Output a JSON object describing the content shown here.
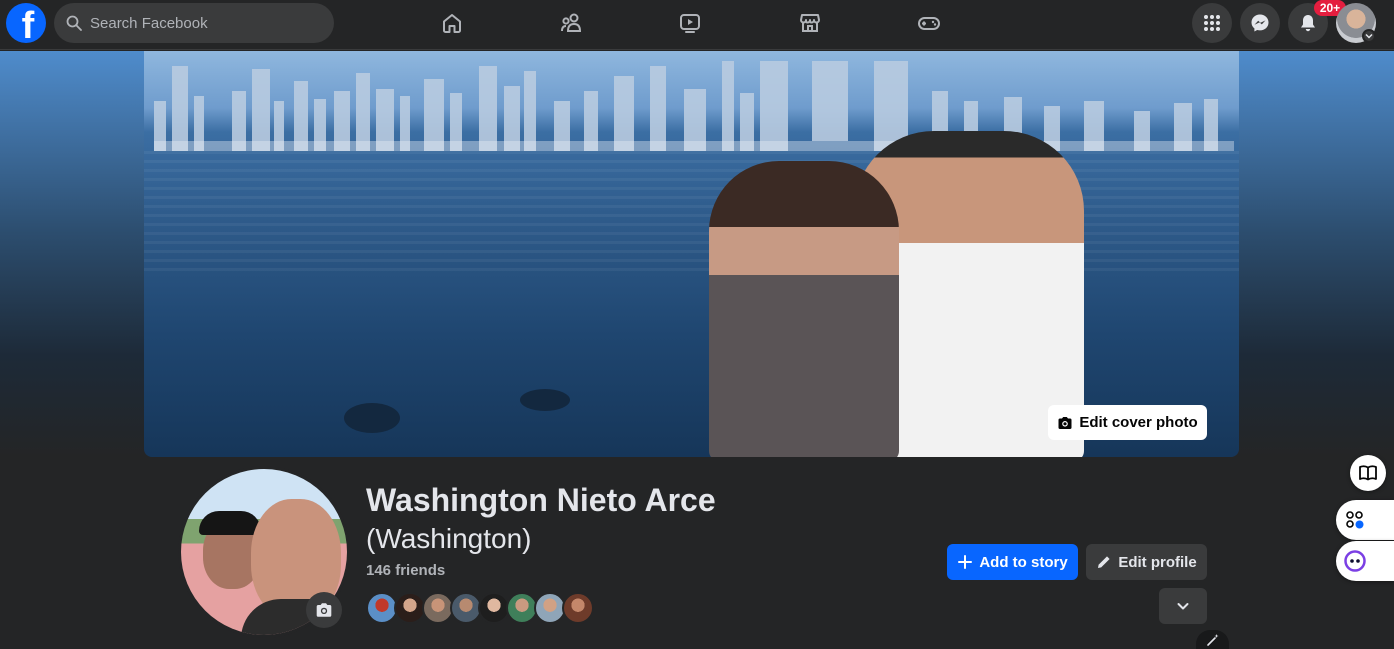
{
  "topbar": {
    "logo": "f",
    "search_placeholder": "Search Facebook",
    "nav_icons": [
      "home-icon",
      "friends-icon",
      "watch-icon",
      "marketplace-icon",
      "gaming-icon"
    ],
    "right_icons": [
      "menu-grid-icon",
      "messenger-icon",
      "notifications-icon"
    ],
    "notification_badge": "20+"
  },
  "cover": {
    "edit_cover_label": "Edit cover photo"
  },
  "profile": {
    "name": "Washington Nieto Arce",
    "alternate_name": "(Washington)",
    "friends_count": "146 friends",
    "friend_avatar_count": 8
  },
  "actions": {
    "add_story_label": "Add to story",
    "edit_profile_label": "Edit profile"
  },
  "colors": {
    "accent": "#0866ff",
    "background": "#242526",
    "surface": "#3a3b3c",
    "badge": "#e41e3f",
    "text": "#e4e6eb",
    "secondary_text": "#b0b3b8"
  }
}
